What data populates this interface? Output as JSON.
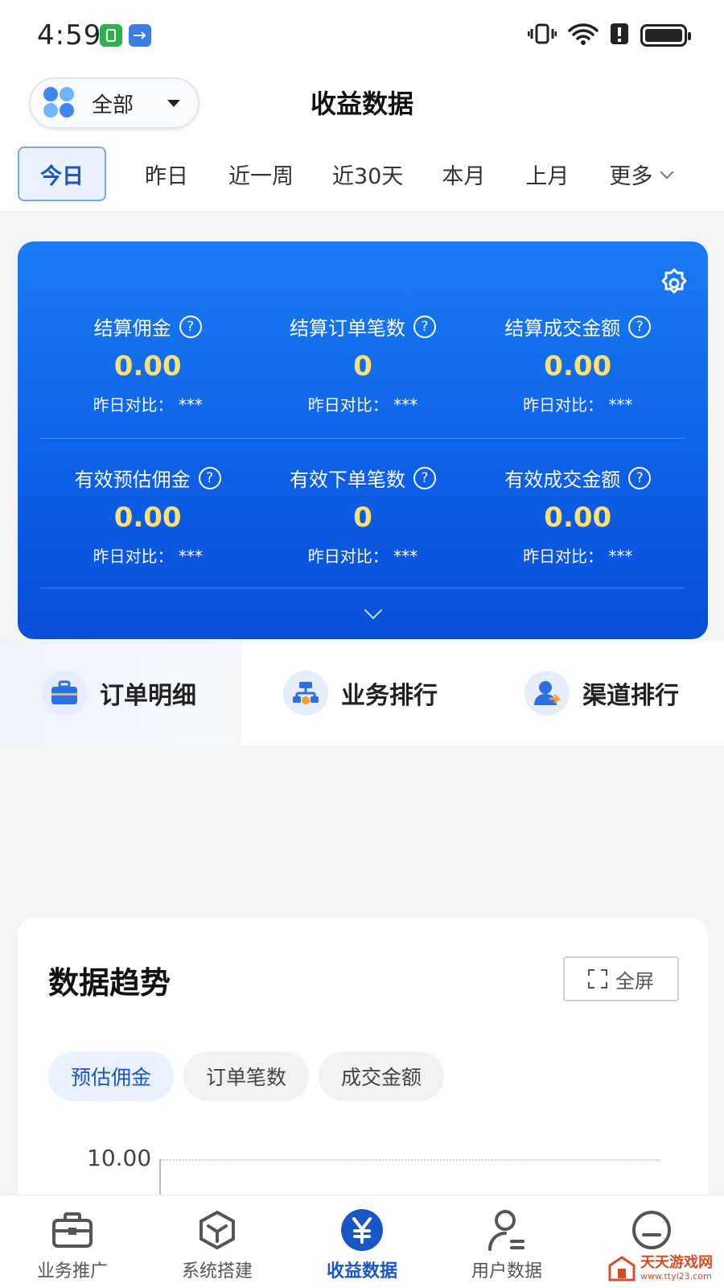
{
  "status_bar": {
    "time": "4:59",
    "icons": [
      "app-notification-icon",
      "usb-icon",
      "vibrate-icon",
      "wifi-icon",
      "alert-icon",
      "battery-icon"
    ]
  },
  "header": {
    "scope": "全部",
    "title": "收益数据"
  },
  "date_tabs": {
    "items": [
      "今日",
      "昨日",
      "近一周",
      "近30天",
      "本月",
      "上月"
    ],
    "more": "更多",
    "active_index": 0
  },
  "stats": {
    "rows": [
      [
        {
          "label": "结算佣金",
          "value": "0.00",
          "compare_label": "昨日对比：",
          "compare_value": "***"
        },
        {
          "label": "结算订单笔数",
          "value": "0",
          "compare_label": "昨日对比：",
          "compare_value": "***"
        },
        {
          "label": "结算成交金额",
          "value": "0.00",
          "compare_label": "昨日对比：",
          "compare_value": "***"
        }
      ],
      [
        {
          "label": "有效预估佣金",
          "value": "0.00",
          "compare_label": "昨日对比：",
          "compare_value": "***"
        },
        {
          "label": "有效下单笔数",
          "value": "0",
          "compare_label": "昨日对比：",
          "compare_value": "***"
        },
        {
          "label": "有效成交金额",
          "value": "0.00",
          "compare_label": "昨日对比：",
          "compare_value": "***"
        }
      ]
    ],
    "help_glyph": "?"
  },
  "quick_nav": {
    "items": [
      {
        "label": "订单明细",
        "icon": "briefcase-icon"
      },
      {
        "label": "业务排行",
        "icon": "hierarchy-icon"
      },
      {
        "label": "渠道排行",
        "icon": "user-share-icon"
      }
    ]
  },
  "trend": {
    "title": "数据趋势",
    "fullscreen_label": "全屏",
    "metric_tabs": [
      "预估佣金",
      "订单笔数",
      "成交金额"
    ],
    "active_metric": 0,
    "y_tick_top": "10.00"
  },
  "bottom_nav": {
    "items": [
      {
        "label": "业务推广",
        "icon": "toolbox-icon"
      },
      {
        "label": "系统搭建",
        "icon": "cube-icon"
      },
      {
        "label": "收益数据",
        "icon": "yen-icon"
      },
      {
        "label": "用户数据",
        "icon": "user-icon"
      },
      {
        "label": "",
        "icon": "face-icon"
      }
    ],
    "active_index": 2
  },
  "watermark": {
    "title": "天天游戏网",
    "url": "www.ttyl23.com"
  },
  "colors": {
    "accent": "#1a56c7",
    "card_gradient_top": "#1a7cf2",
    "card_gradient_bottom": "#0a4fd8",
    "stat_value": "#ffe173"
  }
}
